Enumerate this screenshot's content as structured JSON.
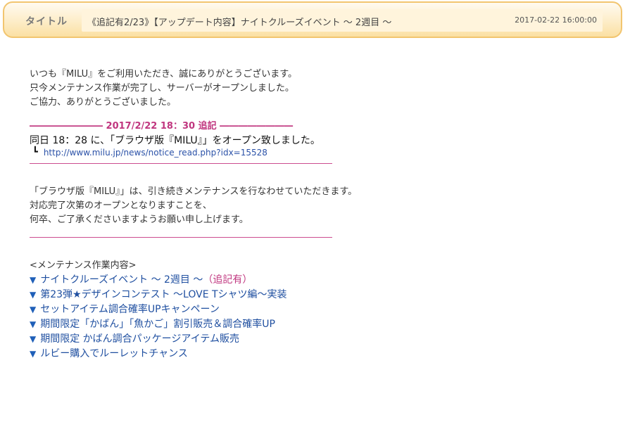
{
  "header": {
    "label": "タイトル",
    "title": "《追記有2/23》【アップデート内容】ナイトクルーズイベント 〜 2週目 〜",
    "date": "2017-02-22 16:00:00"
  },
  "body": {
    "greeting": "いつも『MILU』をご利用いただき、誠にありがとうございます。",
    "server_line1": "只今メンテナンス作業が完了し、サーバーがオープンしました。",
    "server_line2": "ご協力、ありがとうございました。",
    "addendum_heading": "―――――――― 2017/2/22 18：30 追記 ――――――――",
    "browser_open": "同日 18：28 に、「ブラウザ版『MILU』」をオープン致しました。",
    "link_url": "http://www.milu.jp/news/notice_read.php?idx=15528",
    "browser_maint": "「ブラウザ版『MILU』」は、引き続きメンテナンスを行なわせていただきます。",
    "open_line1": "対応完了次第のオープンとなりますことを、",
    "open_line2": "何卒、ご了承くださいますようお願い申し上げます。",
    "maint_heading": "<メンテナンス作業内容>",
    "items": [
      {
        "label": "ナイトクルーズイベント 〜 2週目 〜",
        "note": "（追記有）"
      },
      {
        "label": "第23弾★デザインコンテスト 〜LOVE Tシャツ編〜実装",
        "note": ""
      },
      {
        "label": "セットアイテム調合確率UPキャンペーン",
        "note": ""
      },
      {
        "label": "期間限定「かばん」「魚かご」割引販売＆調合確率UP",
        "note": ""
      },
      {
        "label": "期間限定 かばん調合パッケージアイテム販売",
        "note": ""
      },
      {
        "label": "ルビー購入でルーレットチャンス",
        "note": ""
      }
    ]
  }
}
